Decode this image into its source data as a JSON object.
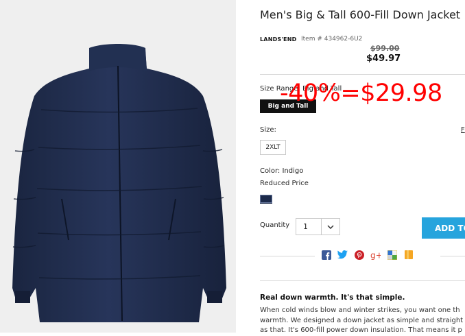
{
  "product": {
    "title": "Men's Big & Tall 600-Fill Down Jacket",
    "brand": "LANDS'END",
    "item_number": "Item # 434962-6U2",
    "old_price": "$99.00",
    "price": "$49.97"
  },
  "size_range": {
    "label": "Size Range: Big and Tall",
    "selected": "Big and Tall"
  },
  "promo_overlay": "-40%=$29.98",
  "size": {
    "label": "Size:",
    "chart_link": "F",
    "selected": "2XLT"
  },
  "color": {
    "label": "Color: Indigo",
    "note": "Reduced Price",
    "swatch_color": "#1c2a4a"
  },
  "quantity": {
    "label": "Quantity",
    "value": "1"
  },
  "add_to_bag_label": "ADD TO",
  "share_icons": [
    "facebook-icon",
    "twitter-icon",
    "pinterest-icon",
    "google-plus-icon",
    "delicious-icon",
    "bookmark-icon"
  ],
  "description": {
    "title": "Real down warmth. It's that simple.",
    "lines": [
      "When cold winds blow and winter strikes, you want one th",
      "warmth. We designed a down jacket as simple and straight",
      "as that. It's 600-fill power down insulation. That means it p"
    ]
  },
  "colors": {
    "accent": "#26a4dd",
    "promo": "#ff0000",
    "jacket": "#1f2b4b"
  }
}
